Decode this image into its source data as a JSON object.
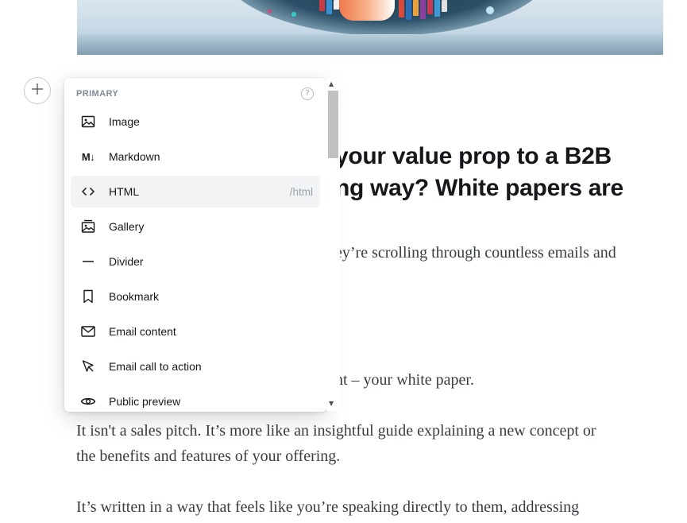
{
  "article": {
    "heading_lines": [
      "your value prop to a B2B",
      "ng way? White papers are"
    ],
    "paragraphs": [
      [
        "ey’re scrolling through countless emails and"
      ],
      [
        "nt – your white paper."
      ],
      [
        "It isn't a sales pitch. It’s more like an insightful guide explaining a new concept or",
        "the benefits and features of your offering."
      ],
      [
        "It’s written in a way that feels like you’re speaking directly to them, addressing"
      ]
    ]
  },
  "add_button": {
    "icon": "plus-icon"
  },
  "card_menu": {
    "section_label": "PRIMARY",
    "help_icon": "help-icon",
    "help_glyph": "?",
    "items": [
      {
        "label": "Image",
        "icon": "image-icon",
        "shortcut": ""
      },
      {
        "label": "Markdown",
        "icon": "markdown-icon",
        "shortcut": ""
      },
      {
        "label": "HTML",
        "icon": "code-icon",
        "shortcut": "/html"
      },
      {
        "label": "Gallery",
        "icon": "gallery-icon",
        "shortcut": ""
      },
      {
        "label": "Divider",
        "icon": "divider-icon",
        "shortcut": ""
      },
      {
        "label": "Bookmark",
        "icon": "bookmark-icon",
        "shortcut": ""
      },
      {
        "label": "Email content",
        "icon": "email-icon",
        "shortcut": ""
      },
      {
        "label": "Email call to action",
        "icon": "cursor-icon",
        "shortcut": ""
      },
      {
        "label": "Public preview",
        "icon": "eye-icon",
        "shortcut": ""
      }
    ],
    "markdown_glyph": "M↓",
    "active_index": 2
  },
  "scrollbar": {
    "up_arrow": "▲",
    "down_arrow": "▼"
  },
  "colors": {
    "heading": "#15171a",
    "body_text": "#3a3d40",
    "section_label": "#7c8b9a",
    "active_item_bg": "#f2f3f4",
    "shortcut": "#9aa3ab"
  }
}
